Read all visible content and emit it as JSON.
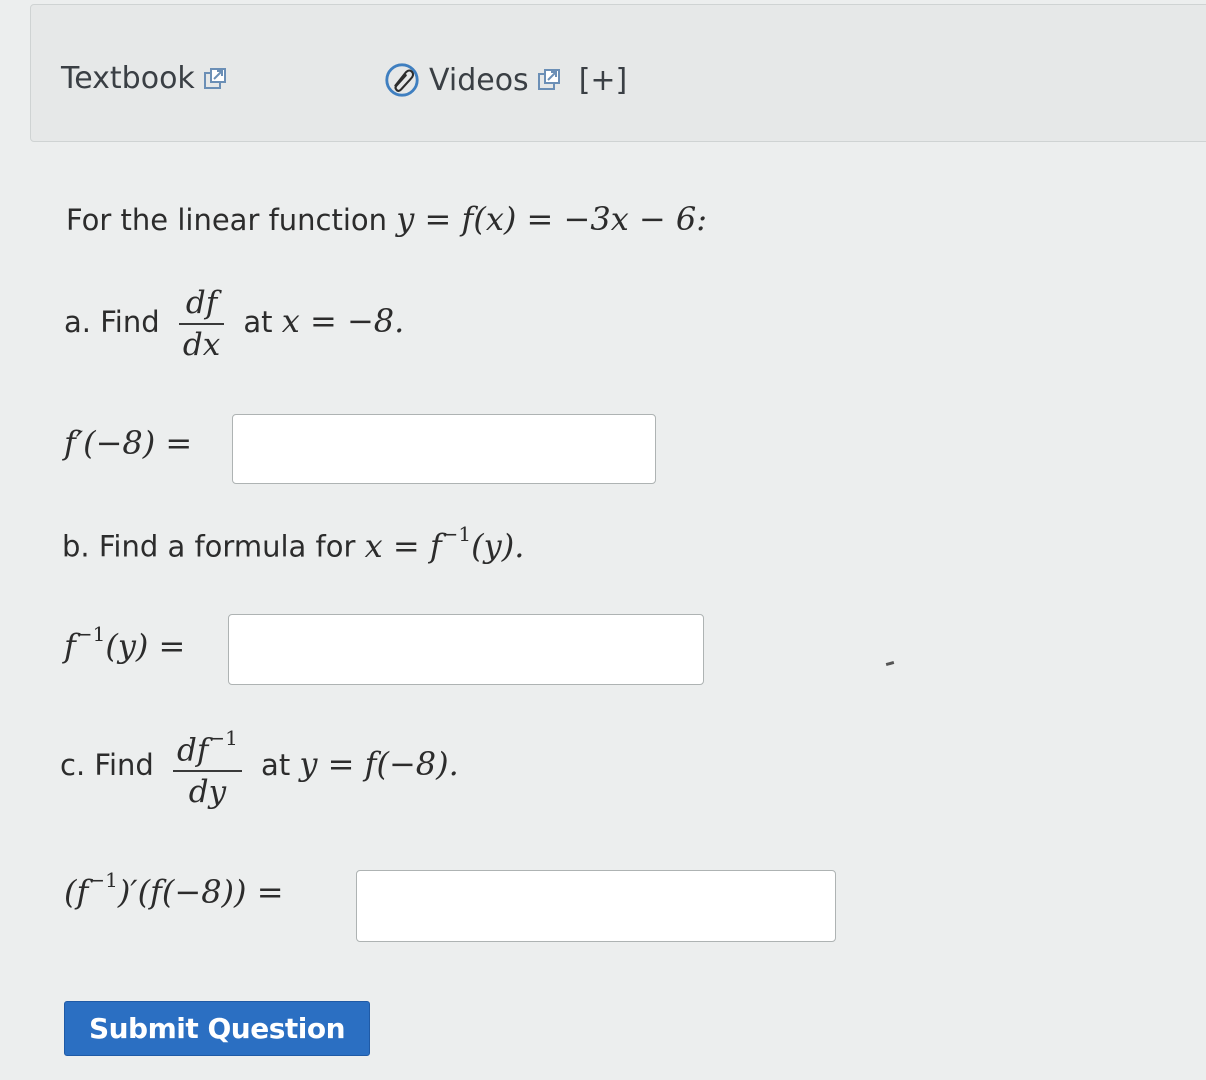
{
  "resources": {
    "textbook_label": "Textbook",
    "videos_label": "Videos",
    "expand_label": "[+]",
    "icons": [
      "external-link-icon",
      "paperclip-icon"
    ]
  },
  "problem": {
    "intro_text": "For the linear function",
    "intro_math": "y = f(x) = −3x − 6:",
    "part_a": {
      "prefix": "a. Find",
      "frac_num": "df",
      "frac_den": "dx",
      "suffix_text": "at",
      "suffix_math": "x = −8.",
      "answer_label": "f′(−8) ="
    },
    "part_b": {
      "prefix": "b. Find a formula for",
      "math_lhs": "x = f",
      "math_sup": "−1",
      "math_rhs": "(y).",
      "answer_label_f": "f",
      "answer_label_sup": "−1",
      "answer_label_rest": "(y) ="
    },
    "part_c": {
      "prefix": "c. Find",
      "frac_num_base": "df",
      "frac_num_sup": "−1",
      "frac_den": "dy",
      "suffix_text": "at",
      "suffix_math": "y = f(−8).",
      "answer_label_open": "(f",
      "answer_label_sup": "−1",
      "answer_label_rest": ")′(f(−8)) ="
    }
  },
  "submit_label": "Submit Question",
  "colors": {
    "submit_bg": "#2b6fc2",
    "page_bg": "#eceeee"
  }
}
